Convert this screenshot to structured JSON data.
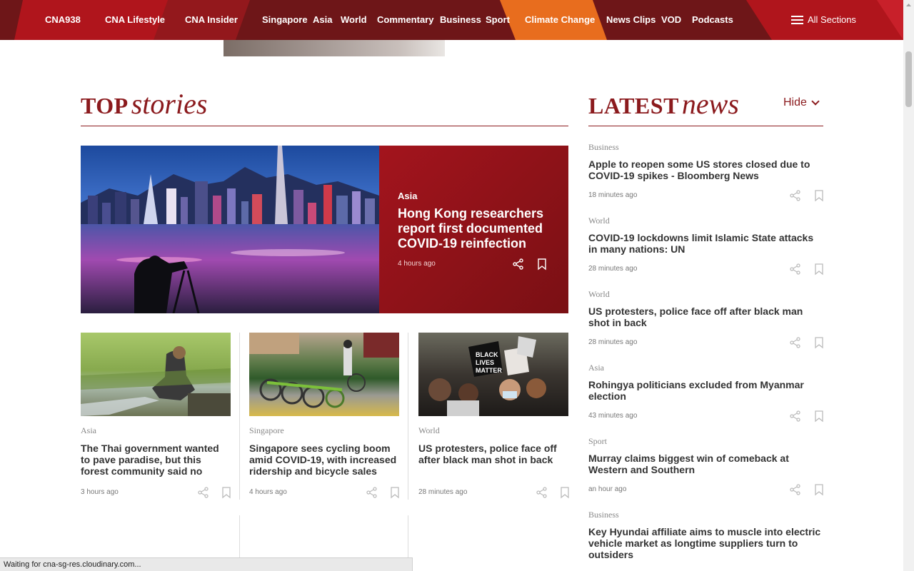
{
  "nav": {
    "items": [
      "CNA938",
      "CNA Lifestyle",
      "CNA Insider",
      "Singapore",
      "Asia",
      "World",
      "Commentary",
      "Business",
      "Sport",
      "Climate Change",
      "News Clips",
      "VOD",
      "Podcasts"
    ],
    "all_sections": "All Sections"
  },
  "top_stories": {
    "title_bold": "TOP",
    "title_italic": "stories",
    "lead": {
      "category": "Asia",
      "title": "Hong Kong researchers report first documented COVID-19 reinfection",
      "time": "4 hours ago"
    },
    "cards": [
      {
        "category": "Asia",
        "title": "The Thai government wanted to pave paradise, but this forest community said no",
        "time": "3 hours ago"
      },
      {
        "category": "Singapore",
        "title": "Singapore sees cycling boom amid COVID-19, with increased ridership and bicycle sales",
        "time": "4 hours ago"
      },
      {
        "category": "World",
        "title": "US protesters, police face off after black man shot in back",
        "time": "28 minutes ago"
      }
    ]
  },
  "latest_news": {
    "title_bold": "LATEST",
    "title_italic": "news",
    "hide_label": "Hide",
    "items": [
      {
        "category": "Business",
        "title": "Apple to reopen some US stores closed due to COVID-19 spikes - Bloomberg News",
        "time": "18 minutes ago"
      },
      {
        "category": "World",
        "title": "COVID-19 lockdowns limit Islamic State attacks in many nations: UN",
        "time": "28 minutes ago"
      },
      {
        "category": "World",
        "title": "US protesters, police face off after black man shot in back",
        "time": "28 minutes ago"
      },
      {
        "category": "Asia",
        "title": "Rohingya politicians excluded from Myanmar election",
        "time": "43 minutes ago"
      },
      {
        "category": "Sport",
        "title": "Murray claims biggest win of comeback at Western and Southern",
        "time": "an hour ago"
      },
      {
        "category": "Business",
        "title": "Key Hyundai affiliate aims to muscle into electric vehicle market as longtime suppliers turn to outsiders",
        "time": ""
      }
    ]
  },
  "status_bar": "Waiting for cna-sg-res.cloudinary.com...",
  "colors": {
    "brand": "#8b1a1d",
    "nav_bg": "#6e1618",
    "accent_orange": "#e86d1e"
  }
}
